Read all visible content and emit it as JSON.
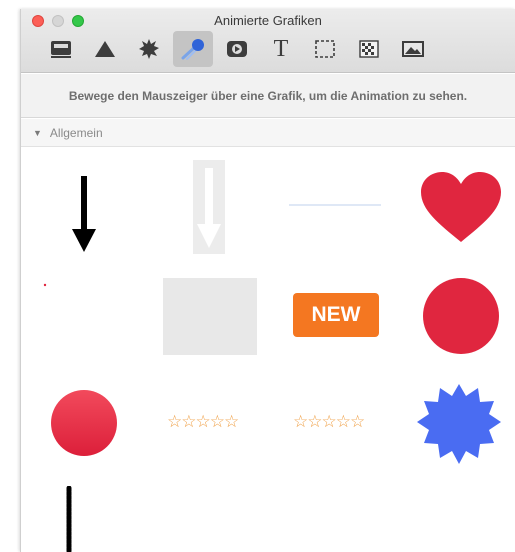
{
  "window": {
    "title": "Animierte Grafiken"
  },
  "toolbar": {
    "items": [
      {
        "icon": "stack-icon",
        "selected": false
      },
      {
        "icon": "triangle-icon",
        "selected": false
      },
      {
        "icon": "starburst-icon",
        "selected": false
      },
      {
        "icon": "comet-icon",
        "selected": true
      },
      {
        "icon": "play-icon",
        "selected": false
      },
      {
        "icon": "text-icon",
        "selected": false
      },
      {
        "icon": "selection-icon",
        "selected": false
      },
      {
        "icon": "checkerboard-icon",
        "selected": false
      },
      {
        "icon": "picture-icon",
        "selected": false
      }
    ],
    "text_glyph": "T"
  },
  "info": {
    "message": "Bewege den Mauszeiger über eine Grafik, um die Animation zu sehen."
  },
  "section": {
    "toggle": "▼",
    "title": "Allgemein"
  },
  "graphics": {
    "new_badge": "NEW",
    "stars_1": "☆☆☆☆☆",
    "stars_2": "☆☆☆☆☆"
  },
  "colors": {
    "red": "#e0263f",
    "orange": "#f47721",
    "blue": "#4a6cf2",
    "star": "#f0a24a",
    "selected_tool": "#c4c4c4"
  }
}
